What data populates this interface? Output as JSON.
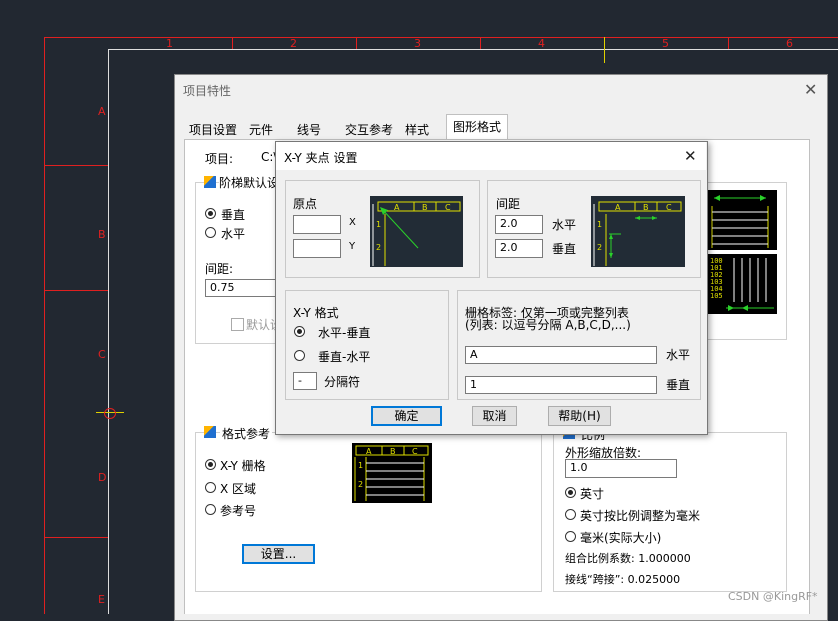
{
  "cad": {
    "ruler_numbers": [
      "1",
      "2",
      "3",
      "4",
      "5",
      "6"
    ],
    "ruler_letters": [
      "A",
      "B",
      "C",
      "D",
      "E"
    ]
  },
  "main_dialog": {
    "title": "项目特性",
    "tabs": [
      "项目设置",
      "元件",
      "线号",
      "交互参考",
      "样式",
      "图形格式"
    ],
    "project_label": "项目:",
    "project_value": "C:\\",
    "ladder_group_title": "阶梯默认设",
    "vertical": "垂直",
    "horizontal": "水平",
    "spacing_label": "间距:",
    "spacing_value": "0.75",
    "default_setting": "默认设",
    "format_ref_title": "格式参考",
    "xy_grid": "X-Y 栅格",
    "x_zone": "X 区域",
    "ref_number": "参考号",
    "settings_button": "设置...",
    "scale_title": "比例",
    "feature_scale_label": "外形缩放倍数:",
    "feature_scale_value": "1.0",
    "inch": "英寸",
    "inch_scaled_mm": "英寸按比例调整为毫米",
    "mm_full": "毫米(实际大小)",
    "combined_scale": "组合比例系数: 1.000000",
    "jumper_gap": "接线“跨接”: 0.025000",
    "preview_numbers": [
      "100",
      "101",
      "102",
      "103",
      "104",
      "105"
    ]
  },
  "xy_dialog": {
    "title": "X-Y 夹点 设置",
    "origin_title": "原点",
    "x_label": "X",
    "y_label": "Y",
    "spacing_title": "间距",
    "spacing_h_value": "2.0",
    "spacing_h_label": "水平",
    "spacing_v_value": "2.0",
    "spacing_v_label": "垂直",
    "xy_format_title": "X-Y 格式",
    "horiz_vert": "水平-垂直",
    "vert_horiz": "垂直-水平",
    "separator_value": "-",
    "separator_label": "分隔符",
    "grid_tag_line1": "栅格标签: 仅第一项或完整列表",
    "grid_tag_line2": "(列表: 以逗号分隔 A,B,C,D,...)",
    "grid_h_value": "A",
    "grid_h_label": "水平",
    "grid_v_value": "1",
    "grid_v_label": "垂直",
    "ok": "确定",
    "cancel": "取消",
    "help": "帮助(H)",
    "preview_cols": [
      "A",
      "B",
      "C"
    ],
    "preview_rows": [
      "1",
      "2"
    ]
  },
  "watermark": "CSDN @KingRF*"
}
